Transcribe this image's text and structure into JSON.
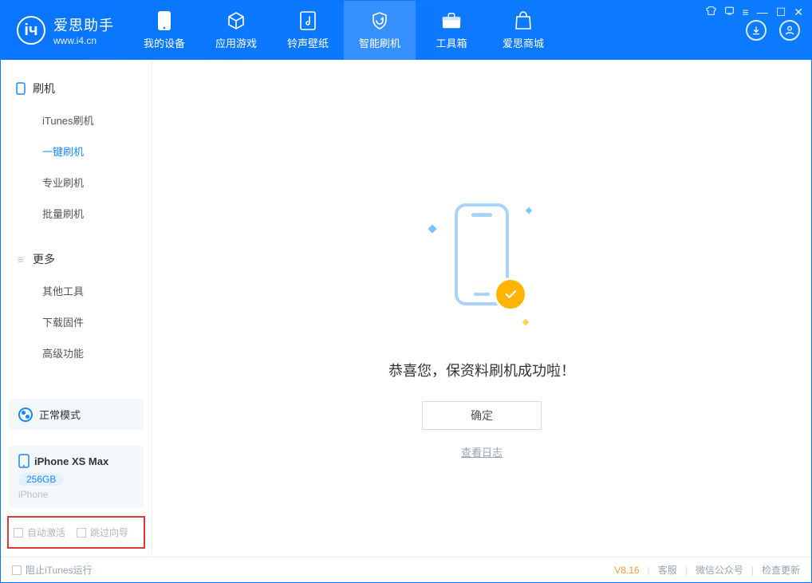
{
  "app": {
    "name": "爱思助手",
    "url": "www.i4.cn"
  },
  "tabs": [
    {
      "label": "我的设备"
    },
    {
      "label": "应用游戏"
    },
    {
      "label": "铃声壁纸"
    },
    {
      "label": "智能刷机"
    },
    {
      "label": "工具箱"
    },
    {
      "label": "爱思商城"
    }
  ],
  "sidebar": {
    "group1": {
      "title": "刷机",
      "items": [
        {
          "label": "iTunes刷机"
        },
        {
          "label": "一键刷机"
        },
        {
          "label": "专业刷机"
        },
        {
          "label": "批量刷机"
        }
      ]
    },
    "group2": {
      "title": "更多",
      "items": [
        {
          "label": "其他工具"
        },
        {
          "label": "下载固件"
        },
        {
          "label": "高级功能"
        }
      ]
    }
  },
  "device": {
    "mode": "正常模式",
    "name": "iPhone XS Max",
    "capacity": "256GB",
    "type": "iPhone"
  },
  "options": {
    "auto_activate": "自动激活",
    "skip_guide": "跳过向导"
  },
  "main": {
    "success_text": "恭喜您，保资料刷机成功啦！",
    "ok_label": "确定",
    "log_link": "查看日志"
  },
  "footer": {
    "block_itunes": "阻止iTunes运行",
    "version": "V8.16",
    "support": "客服",
    "wechat": "微信公众号",
    "check_update": "检查更新"
  }
}
